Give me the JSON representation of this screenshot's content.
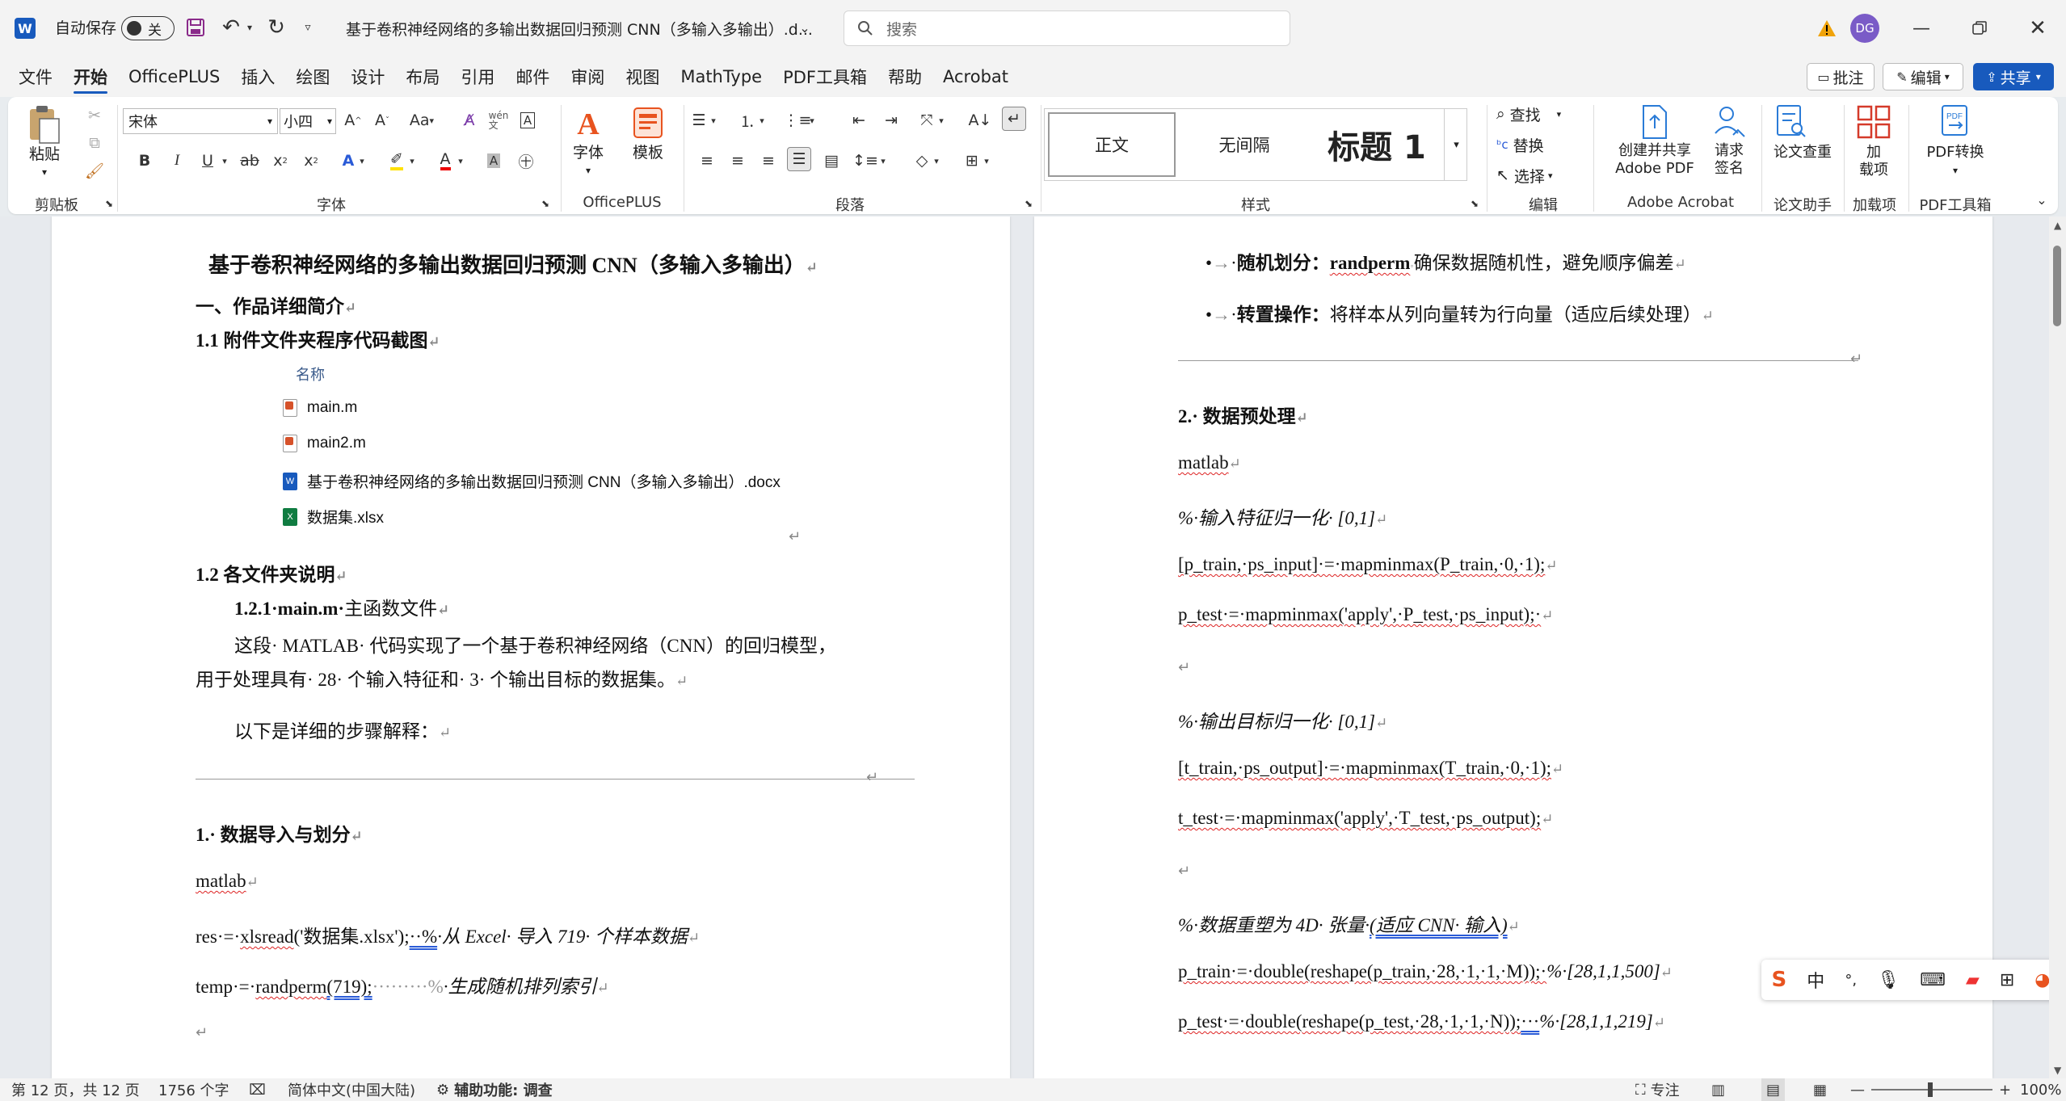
{
  "window": {
    "autosave_label": "自动保存",
    "autosave_state": "关",
    "doc_title": "基于卷积神经网络的多输出数据回归预测 CNN（多输入多输出）.d...",
    "search_placeholder": "搜索",
    "user_initials": "DG"
  },
  "menu": [
    "文件",
    "开始",
    "OfficePLUS",
    "插入",
    "绘图",
    "设计",
    "布局",
    "引用",
    "邮件",
    "审阅",
    "视图",
    "MathType",
    "PDF工具箱",
    "帮助",
    "Acrobat"
  ],
  "menu_right": {
    "comment": "批注",
    "edit": "编辑",
    "share": "共享"
  },
  "ribbon": {
    "clipboard": {
      "paste": "粘贴",
      "label": "剪贴板"
    },
    "font": {
      "name": "宋体",
      "size": "小四",
      "label": "字体"
    },
    "officeplus": {
      "font_btn": "字体",
      "template_btn": "模板",
      "label": "OfficePLUS"
    },
    "paragraph": {
      "label": "段落"
    },
    "styles": {
      "items": [
        "正文",
        "无间隔",
        "标题 1"
      ],
      "label": "样式"
    },
    "editing": {
      "find": "查找",
      "replace": "替换",
      "select": "选择",
      "label": "编辑"
    },
    "adobe": {
      "create_share": "创建并共享",
      "adobe_pdf": "Adobe PDF",
      "request": "请求",
      "sign": "签名",
      "label": "Adobe Acrobat"
    },
    "paper": {
      "check": "论文查重",
      "label": "论文助手"
    },
    "addins": {
      "add": "加",
      "items": "载项",
      "label": "加载项"
    },
    "pdf": {
      "convert": "PDF转换",
      "label": "PDF工具箱"
    }
  },
  "page1": {
    "title": "基于卷积神经网络的多输出数据回归预测 CNN（多输入多输出）",
    "h1": "一、作品详细简介",
    "h11": "1.1 附件文件夹程序代码截图",
    "file_col_header": "名称",
    "files": [
      {
        "name": "main.m",
        "type": "m"
      },
      {
        "name": "main2.m",
        "type": "m"
      },
      {
        "name": "基于卷积神经网络的多输出数据回归预测 CNN（多输入多输出）.docx",
        "type": "docx"
      },
      {
        "name": "数据集.xlsx",
        "type": "xlsx"
      }
    ],
    "h12": "1.2 各文件夹说明",
    "h121_prefix": "1.2.1",
    "h121_bold": "main.m",
    "h121_suffix": "主函数文件",
    "para1_line1": "这段· MATLAB· 代码实现了一个基于卷积神经网络（CNN）的回归模型，",
    "para1_line2": "用于处理具有· 28· 个输入特征和· 3· 个输出目标的数据集。",
    "para2": "以下是详细的步骤解释：",
    "sec1": "1.· 数据导入与划分",
    "code_lang": "matlab",
    "code1_pre": "res·=·",
    "code1_fn": "xlsread",
    "code1_arg": "('数据集.xlsx');",
    "code1_dots": "··%",
    "code1_comment": "·从 Excel· 导入 719· 个样本数据",
    "code2_pre": "temp·=·",
    "code2_fn": "randperm",
    "code2_arg": "(719);",
    "code2_dots": "·········%",
    "code2_comment": "·生成随机排列索引"
  },
  "page2": {
    "bullet1_label": "随机划分：",
    "bullet1_code": "randperm",
    "bullet1_text": "确保数据随机性，避免顺序偏差",
    "bullet2_label": "转置操作：",
    "bullet2_text": "将样本从列向量转为行向量（适应后续处理）",
    "sec2": "2.· 数据预处理",
    "code_lang": "matlab",
    "c1": "%·输入特征归一化· [0,1]",
    "c2": "[p_train,·ps_input]·=·mapminmax(P_train,·0,·1);",
    "c3": "p_test·=·mapminmax('apply',·P_test,·ps_input);·",
    "c4": "%·输出目标归一化· [0,1]",
    "c5": "[t_train,·ps_output]·=·mapminmax(T_train,·0,·1);",
    "c6": "t_test·=·mapminmax('apply',·T_test,·ps_output);",
    "c7_pre": "%·数据重塑为 4D· 张量·",
    "c7_link": "(适应 CNN· 输入)",
    "c8_code": "p_train·=·double(reshape(p_train,·28,·1,·1,·M));·",
    "c8_comment": "%·[28,1,1,500]",
    "c9_code": "p_test·=·double(reshape(p_test,·28,·1,·1,·N));",
    "c9_dots": "···",
    "c9_comment": "%·[28,1,1,219]"
  },
  "ime": {
    "lang": "中"
  },
  "status": {
    "page": "第 12 页，共 12 页",
    "words": "1756 个字",
    "language": "简体中文(中国大陆)",
    "accessibility": "辅助功能: 调查",
    "focus": "专注",
    "zoom": "100%"
  },
  "colors": {
    "accent": "#185abd",
    "share_bg": "#185abd",
    "word_icon": "#185abd",
    "excel_icon": "#107c41"
  }
}
